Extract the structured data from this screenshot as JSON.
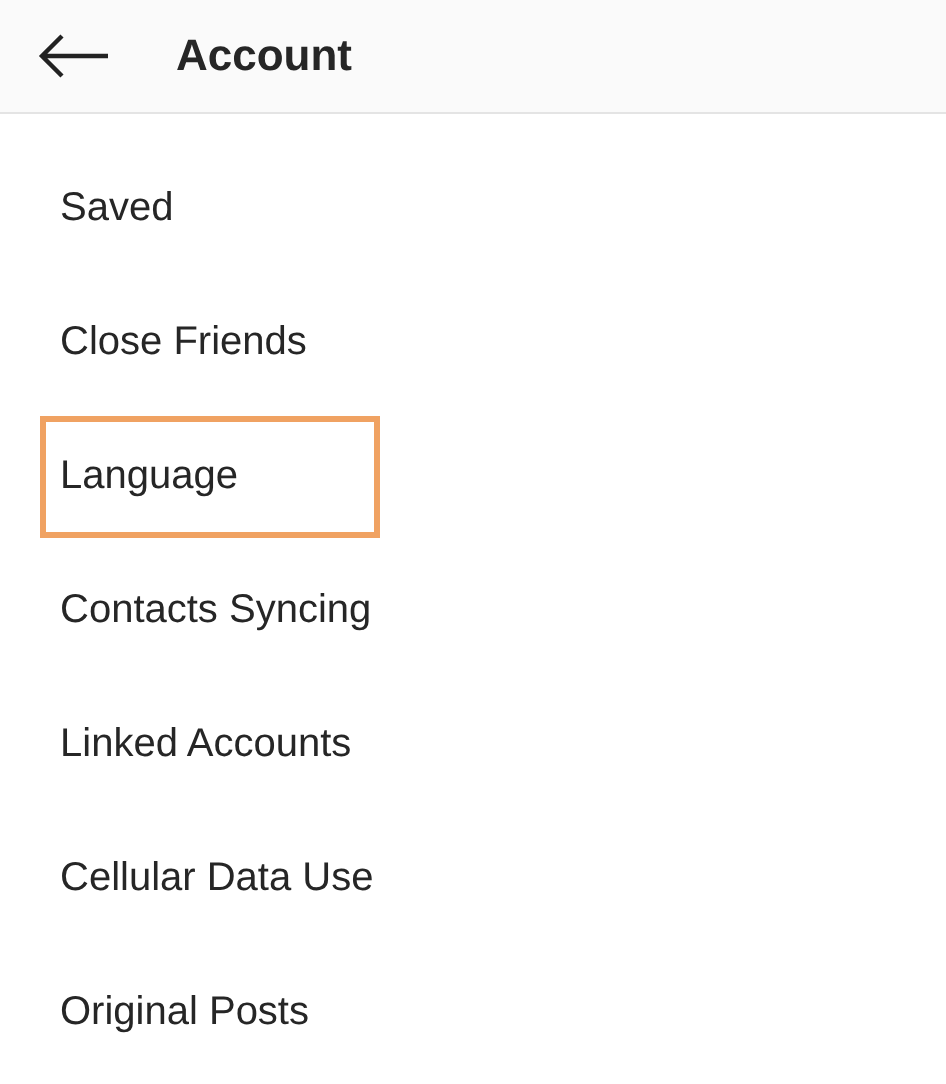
{
  "header": {
    "title": "Account"
  },
  "items": [
    {
      "label": "Saved",
      "highlighted": false
    },
    {
      "label": "Close Friends",
      "highlighted": false
    },
    {
      "label": "Language",
      "highlighted": true
    },
    {
      "label": "Contacts Syncing",
      "highlighted": false
    },
    {
      "label": "Linked Accounts",
      "highlighted": false
    },
    {
      "label": "Cellular Data Use",
      "highlighted": false
    },
    {
      "label": "Original Posts",
      "highlighted": false
    }
  ]
}
